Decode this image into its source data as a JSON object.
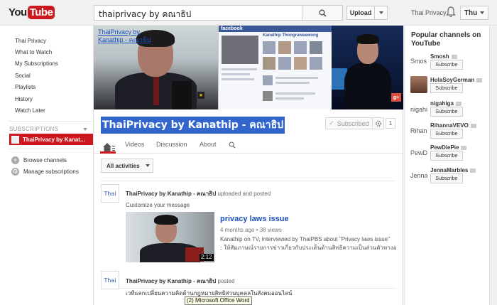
{
  "header": {
    "logo_you": "You",
    "logo_tube": "Tube",
    "search_value": "thaiprivacy by คณาธิป",
    "upload_label": "Upload",
    "account_name": "Thai Privacy",
    "account_button": "Thu"
  },
  "sidebar": {
    "items": [
      {
        "label": "Thai Privacy"
      },
      {
        "label": "What to Watch"
      },
      {
        "label": "My Subscriptions"
      },
      {
        "label": "Social"
      },
      {
        "label": "Playlists"
      },
      {
        "label": "History"
      },
      {
        "label": "Watch Later"
      }
    ],
    "subscriptions_heading": "SUBSCRIPTIONS",
    "active_subscription": "ThaiPrivacy by Kanat...",
    "browse_channels": "Browse channels",
    "manage_subscriptions": "Manage subscriptions"
  },
  "banner": {
    "overlay_text": "ThaiPrivacy by Kanathip - คณาธิป",
    "fb_brand": "facebook",
    "fb_name": "Kanathip Thongraweewong",
    "gplus": "g+"
  },
  "channel": {
    "title": "ThaiPrivacy by Kanathip - คณาธิป",
    "subscribed_label": "Subscribed",
    "subscriber_count": "1"
  },
  "tabs": {
    "videos": "Videos",
    "discussion": "Discussion",
    "about": "About"
  },
  "feed": {
    "filter_label": "All activities",
    "avatar_text": "Thai",
    "post1": {
      "author": "ThaiPrivacy by Kanathip - คณาธิป",
      "action": "uploaded and posted",
      "customize": "Customize your message",
      "duration": "2:12",
      "video_title": "privacy laws issue",
      "meta": "4 months ago • 38 views",
      "desc1": "Kanathip on TV, interviewed by ThaiPBS about \"Privacy laws issue\"",
      "desc2": ": ให้สัมภาษณ์รายการข่าวเกี่ยวกับประเด็นด้านสิทธิความเป็นส่วนตัวทางอ..."
    },
    "post2": {
      "author": "ThaiPrivacy by Kanathip - คณาธิป",
      "action": "posted",
      "text": "เวทีแลกเปลี่ยนความคิดด้านกฎหมายสิทธิส่วนบุคคลในสังคมออนไลน์"
    }
  },
  "taskbar_tooltip": "(2) Microsoft Office Word",
  "popular": {
    "heading": "Popular channels on YouTube",
    "subscribe_label": "Subscribe",
    "channels": [
      {
        "name": "Smosh",
        "avatar": "Smos"
      },
      {
        "name": "HolaSoyGerman",
        "avatar": ""
      },
      {
        "name": "nigahiga",
        "avatar": "nigahi"
      },
      {
        "name": "RihannaVEVO",
        "avatar": "Rihan"
      },
      {
        "name": "PewDiePie",
        "avatar": "PewD"
      },
      {
        "name": "JennaMarbles",
        "avatar": "Jenna"
      }
    ]
  },
  "colors": {
    "brand_red": "#cc181e",
    "link_blue": "#1a4fbf",
    "selection_blue": "#3366cc"
  }
}
